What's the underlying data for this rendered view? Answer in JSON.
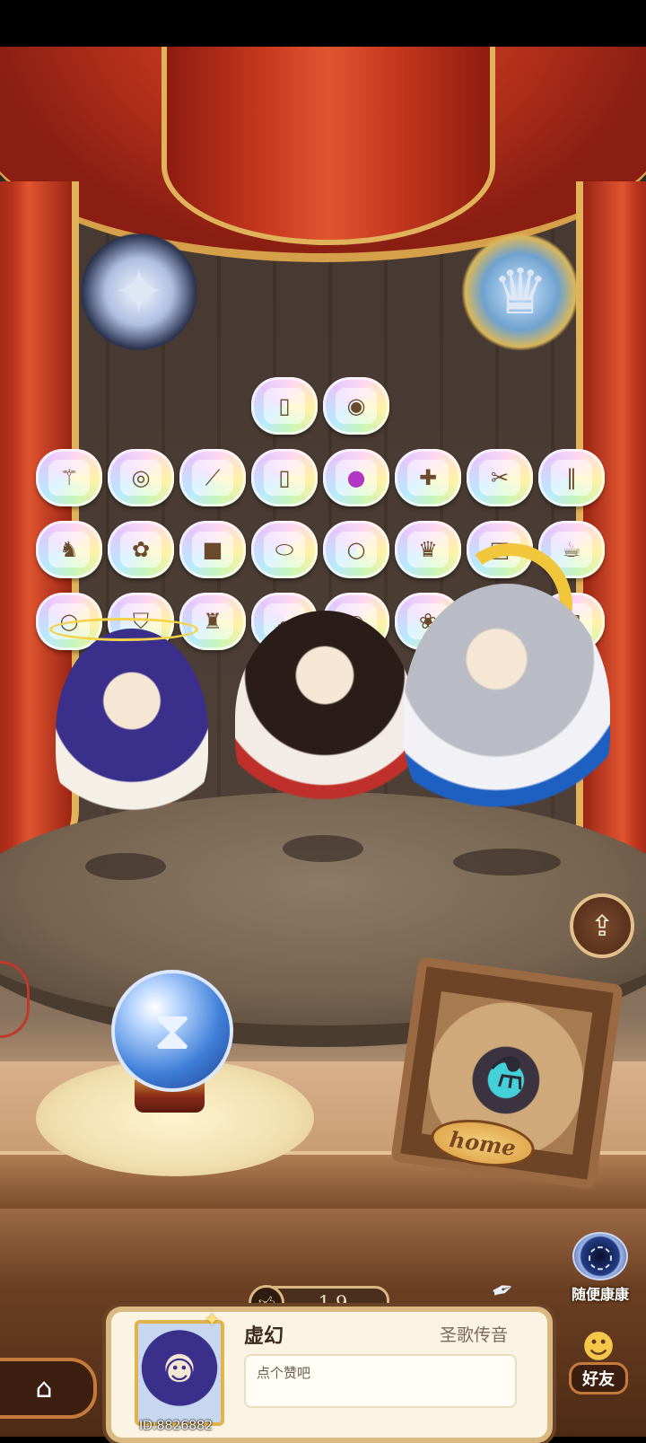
{
  "stage": {
    "emblems": [
      {
        "name": "fox-mask-emblem",
        "icon": "fox-mask"
      },
      {
        "name": "lion-shield-emblem",
        "icon": "lion-shield"
      }
    ],
    "badge_rows": [
      [
        "tarot-card",
        "cake"
      ],
      [
        "magic-wand",
        "bead-bracelet",
        "telescope",
        "tarot-card",
        "button",
        "golden-cross",
        "scissors",
        "safety-pin"
      ],
      [
        "rocking-horse",
        "flower",
        "marshmallow",
        "plate",
        "ring",
        "crown",
        "book",
        "teacup"
      ],
      [
        "ring",
        "shield",
        "brush",
        "ghost",
        "bell",
        "rabbit",
        "dice",
        "envelope"
      ]
    ],
    "characters": [
      "purple-hair-angel",
      "shrine-maiden",
      "moon-sleeper"
    ]
  },
  "actions": {
    "share_icon": "share-icon",
    "random_visit_label": "随便康康",
    "home_sign": "home",
    "crystal_ball_icon": "hourglass-icon"
  },
  "profile": {
    "like_count": "19",
    "name": "虚幻",
    "title": "圣歌传音",
    "comment_placeholder": "点个赞吧",
    "id_label": "ID:8826882"
  },
  "nav": {
    "home_icon": "home-icon",
    "friends_label": "好友"
  }
}
